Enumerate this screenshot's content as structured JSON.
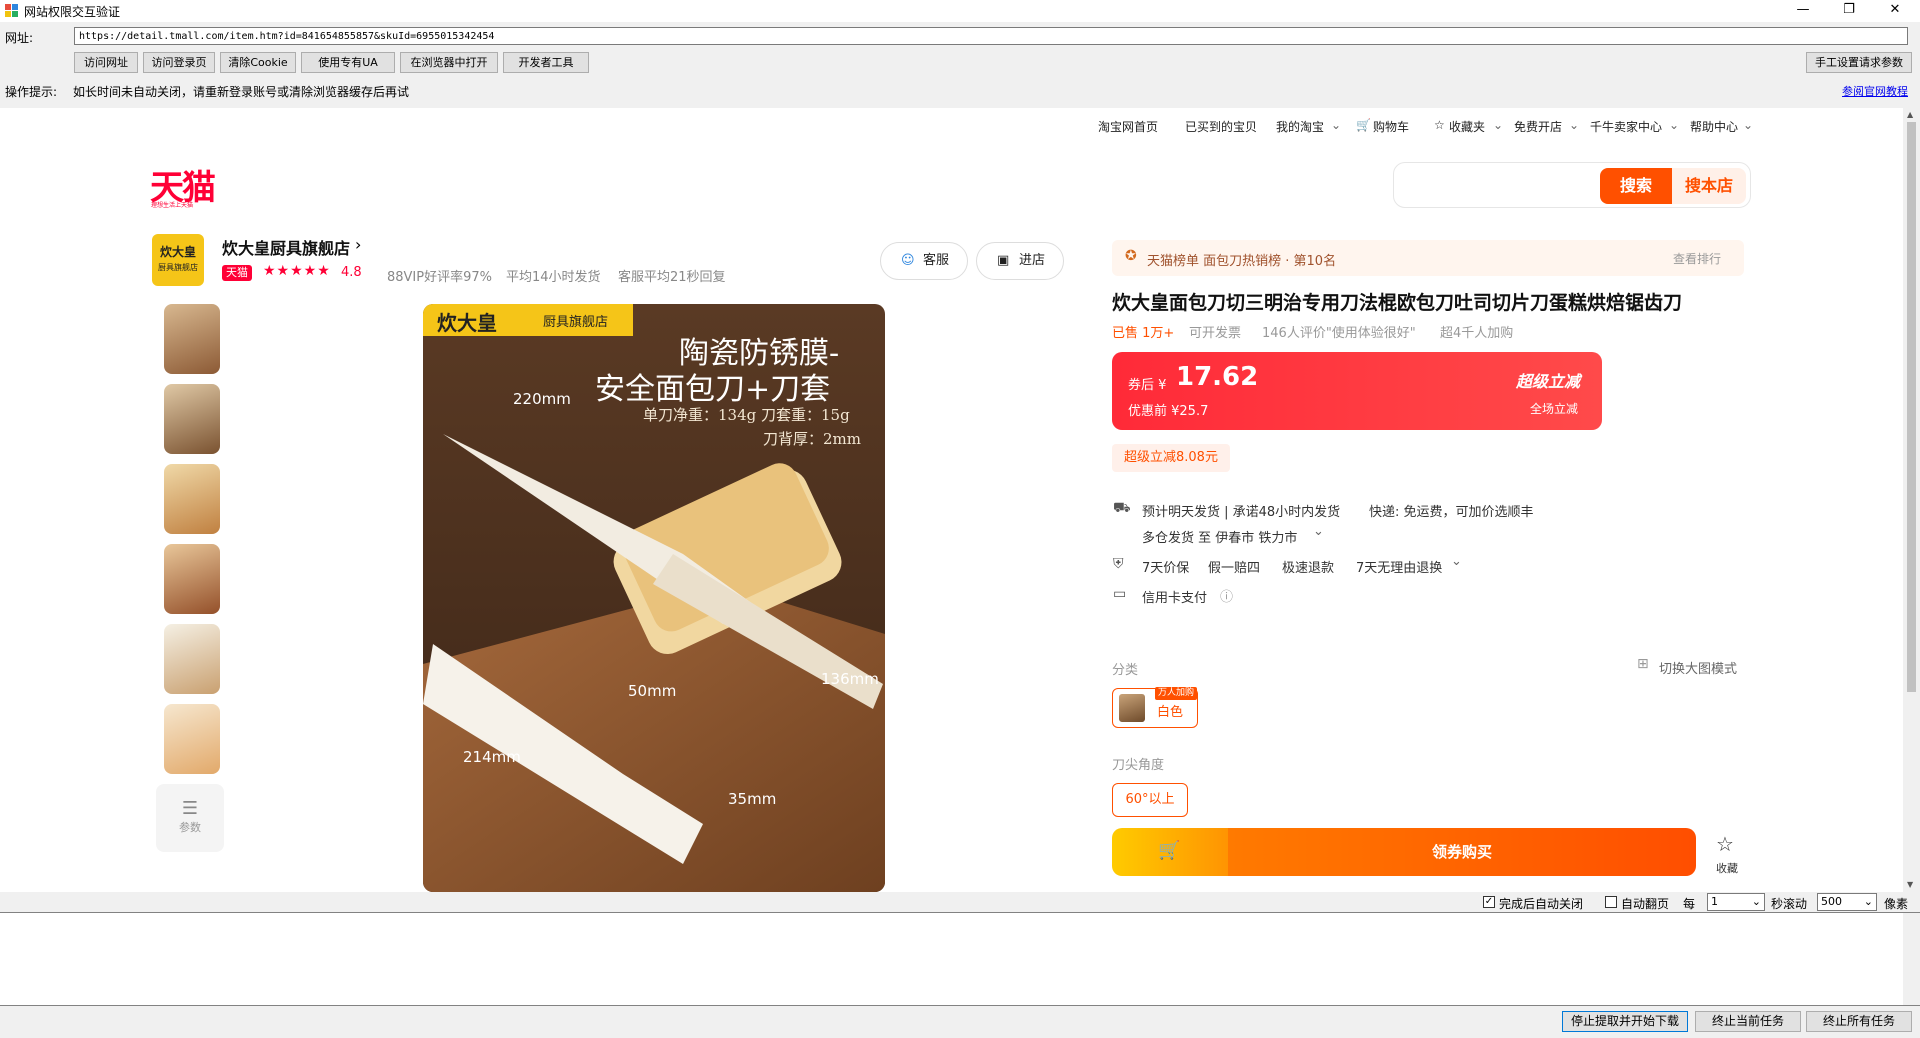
{
  "window": {
    "title": "网站权限交互验证",
    "minimize": "—",
    "restore": "❐",
    "close": "✕"
  },
  "url_label": "网址:",
  "url_value": "https://detail.tmall.com/item.htm?id=841654855857&skuId=6955015342454",
  "toolbar": {
    "buttons": [
      "访问网址",
      "访问登录页",
      "清除Cookie",
      "使用专有UA",
      "在浏览器中打开",
      "开发者工具"
    ],
    "manual": "手工设置请求参数"
  },
  "hint": {
    "label": "操作提示:",
    "text": "如长时间未自动关闭，请重新登录账号或清除浏览器缓存后再试",
    "link": "参阅官网教程"
  },
  "page": {
    "topnav": [
      "淘宝网首页",
      "已买到的宝贝",
      "我的淘宝",
      "购物车",
      "收藏夹",
      "免费开店",
      "千牛卖家中心",
      "帮助中心"
    ],
    "logo": "天猫",
    "logo_sub": "理想生活上天猫",
    "search": {
      "btn1": "搜索",
      "btn2": "搜本店"
    },
    "shop": {
      "logo_line1": "炊大皇",
      "logo_line2": "厨具旗舰店",
      "name": "炊大皇厨具旗舰店",
      "tag": "天猫",
      "stars": "★★★★★",
      "rating": "4.8",
      "meta": [
        "88VIP好评率97%",
        "平均14小时发货",
        "客服平均21秒回复"
      ],
      "service_btn": "客服",
      "enter_btn": "进店"
    },
    "params_label": "参数",
    "main_image": {
      "brand": "炊大皇",
      "store": "厨具旗舰店",
      "headline1": "陶瓷防锈膜-",
      "headline2": "安全面包刀+刀套",
      "spec1": "单刀净重：134g   刀套重：15g",
      "spec2": "刀背厚：2mm",
      "dims": [
        "220mm",
        "136mm",
        "50mm",
        "214mm",
        "35mm"
      ]
    },
    "rank": {
      "text": "天猫榜单 面包刀热销榜 · 第10名",
      "more": "查看排行"
    },
    "title": "炊大皇面包刀切三明治专用刀法棍欧包刀吐司切片刀蛋糕烘焙锯齿刀",
    "stats": {
      "sold": "已售 1万+",
      "invoice": "可开发票",
      "reviews": "146人评价\"使用体验很好\"",
      "cart": "超4千人加购"
    },
    "price": {
      "label": "券后 ¥",
      "value": "17.62",
      "before": "优惠前 ¥25.7",
      "promo": "超级立减",
      "promo_sub": "全场立减"
    },
    "discount_badge": "超级立减8.08元",
    "delivery1": "预计明天发货 | 承诺48小时内发货",
    "delivery1b": "快递: 免运费，可加价选顺丰",
    "delivery2": "多仓发货 至 伊春市 铁力市",
    "guarantee": [
      "7天价保",
      "假一赔四",
      "极速退款",
      "7天无理由退换"
    ],
    "payment": "信用卡支付",
    "category_label": "分类",
    "switch_mode": "切换大图模式",
    "option_tag": "万人加购",
    "option_color": "白色",
    "angle_label": "刀尖角度",
    "angle_option": "60°以上",
    "buy_btn": "领券购买",
    "fav_label": "收藏"
  },
  "bottom": {
    "auto_close": "完成后自动关闭",
    "auto_page": "自动翻页",
    "every": "每",
    "every_value": "1",
    "sec_scroll": "秒滚动",
    "px_value": "500",
    "px_label": "像素",
    "buttons": [
      "停止提取并开始下载",
      "终止当前任务",
      "终止所有任务"
    ]
  },
  "colors": {
    "tmall_red": "#ff0036",
    "taobao_orange": "#ff5000",
    "price_red": "#ff2a38"
  }
}
